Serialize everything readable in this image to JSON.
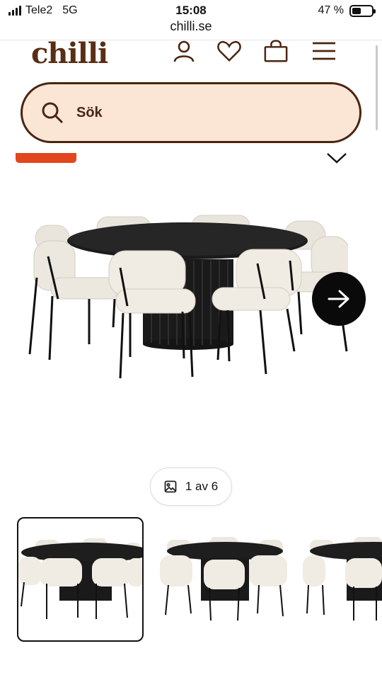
{
  "status_bar": {
    "carrier": "Tele2",
    "network": "5G",
    "time": "15:08",
    "battery_percent": "47 %",
    "battery_level": 0.47
  },
  "browser": {
    "url": "chilli.se"
  },
  "header": {
    "logo": "chilli",
    "icons": [
      "user-icon",
      "heart-icon",
      "bag-icon",
      "menu-icon"
    ]
  },
  "search": {
    "label": "Sök",
    "icon": "search-icon"
  },
  "gallery": {
    "counter": "1 av 6",
    "current": 1,
    "total": 6,
    "next_icon": "arrow-right-icon",
    "counter_icon": "image-icon"
  },
  "colors": {
    "brand": "#5a2e14",
    "search_bg": "#fbe6d6",
    "badge": "#e2461c",
    "black": "#0a0a0a"
  }
}
